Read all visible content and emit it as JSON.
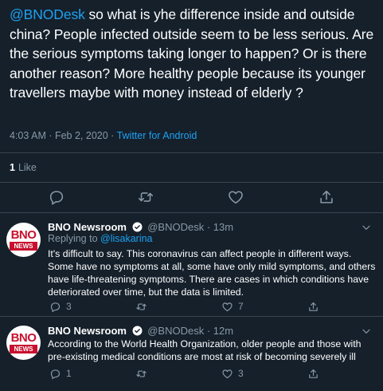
{
  "main_tweet": {
    "mention": "@BNODesk",
    "text": " so what is yhe difference inside and outside china?  People infected outside seem to be less serious. Are the serious symptoms taking longer to happen? Or is there another reason? More healthy people because its younger travellers maybe with money instead of elderly ?",
    "timestamp": "4:03 AM · Feb 2, 2020 · ",
    "source": "Twitter for Android",
    "likes_count": "1",
    "likes_label": "Like"
  },
  "actions": {
    "reply_icon": "reply-icon",
    "retweet_icon": "retweet-icon",
    "like_icon": "heart-icon",
    "share_icon": "share-icon"
  },
  "replies": [
    {
      "avatar_top": "BNO",
      "avatar_bar": "NEWS",
      "name": "BNO Newsroom",
      "handle": "@BNODesk · 13m",
      "replying_prefix": "Replying to ",
      "replying_to": "@lisakarina",
      "text": "It's difficult to say. This coronavirus can affect people in different ways. Some have no symptoms at all, some have only mild symptoms, and others have life-threatening symptoms. There are cases in which conditions have deteriorated over time, but the data is limited.",
      "reply_count": "3",
      "retweet_count": "",
      "like_count": "7"
    },
    {
      "avatar_top": "BNO",
      "avatar_bar": "NEWS",
      "name": "BNO Newsroom",
      "handle": "@BNODesk · 12m",
      "text": "According to the World Health Organization, older people and those with pre-existing medical conditions are most at risk of becoming severely ill",
      "reply_count": "1",
      "retweet_count": "",
      "like_count": "3"
    }
  ],
  "colors": {
    "background": "#15202b",
    "accent": "#1da1f2",
    "secondary_text": "#8899a6",
    "divider": "#38444d",
    "brand_red": "#c8102e"
  }
}
